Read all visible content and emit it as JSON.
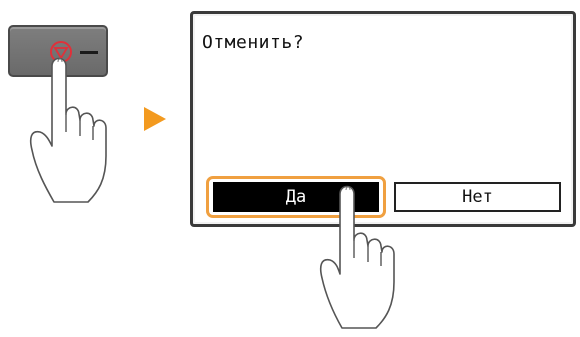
{
  "operation_panel": {
    "stop_key": {
      "icon": "stop-icon",
      "icon_color": "#e0303a"
    }
  },
  "step_arrow": {
    "icon": "play-arrow-icon",
    "color": "#f39a1f"
  },
  "screen": {
    "prompt": "Отменить?",
    "buttons": {
      "yes_label": "Да",
      "no_label": "Нет"
    },
    "highlight_color": "#f0a040"
  }
}
